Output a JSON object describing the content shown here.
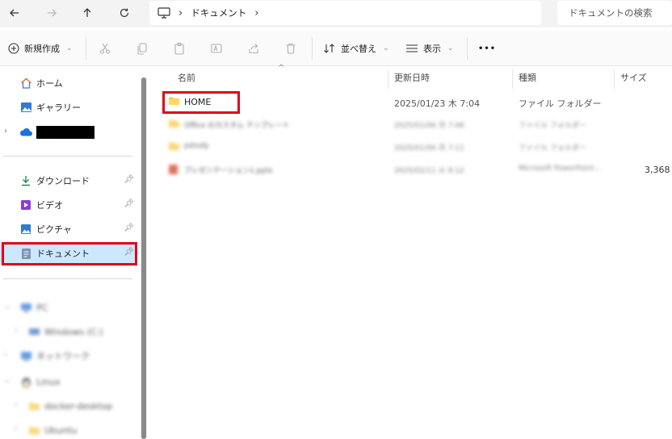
{
  "address_bar": {
    "breadcrumb": [
      "ドキュメント"
    ],
    "search_placeholder": "ドキュメントの検索"
  },
  "toolbar": {
    "new_label": "新規作成",
    "sort_label": "並べ替え",
    "view_label": "表示",
    "more_label": "•••"
  },
  "sidebar": {
    "home": "ホーム",
    "gallery": "ギャラリー",
    "downloads": "ダウンロード",
    "videos": "ビデオ",
    "pictures": "ピクチャ",
    "documents": "ドキュメント",
    "pc": "PC",
    "drive_c": "Windows (C:)",
    "network": "ネットワーク",
    "linux": "Linux",
    "docker": "docker-desktop",
    "ubuntu": "Ubuntu"
  },
  "columns": {
    "name": "名前",
    "modified": "更新日時",
    "type": "種類",
    "size": "サイズ"
  },
  "files": [
    {
      "name": "HOME",
      "modified": "2025/01/23 木 7:04",
      "type": "ファイル フォルダー",
      "size": ""
    },
    {
      "name": "Office のカスタム テンプレート",
      "modified": "2025/01/06 月 7:46",
      "type": "ファイル フォルダー",
      "size": ""
    },
    {
      "name": "pstudy",
      "modified": "2025/01/06 月 7:11",
      "type": "ファイル フォルダー",
      "size": ""
    },
    {
      "name": "プレゼンテーション1.pptx",
      "modified": "2025/02/11 火 8:12",
      "type": "Microsoft PowerPoint...",
      "size": "3,368"
    }
  ],
  "colors": {
    "highlight": "#cce8ff",
    "annotation": "#e0001b",
    "folder": "#f8c84a"
  }
}
